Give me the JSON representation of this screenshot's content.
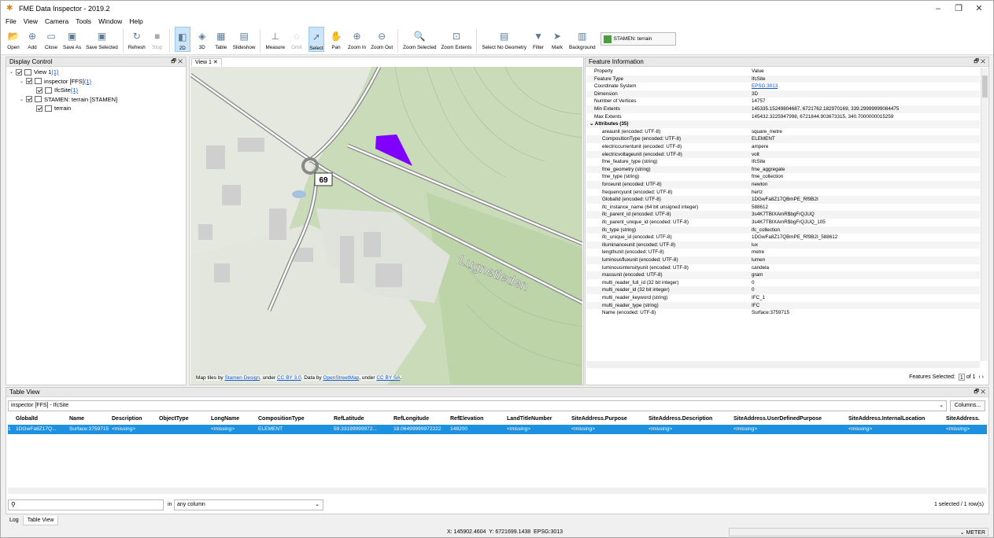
{
  "window": {
    "title": "FME Data Inspector - 2019.2"
  },
  "menu": [
    "File",
    "View",
    "Camera",
    "Tools",
    "Window",
    "Help"
  ],
  "toolbar": [
    {
      "label": "Open",
      "icon": "folder-open-icon"
    },
    {
      "label": "Add",
      "icon": "add-dataset-icon"
    },
    {
      "label": "Close",
      "icon": "folder-close-icon"
    },
    {
      "label": "Save As",
      "icon": "save-as-icon"
    },
    {
      "label": "Save Selected",
      "icon": "save-selected-icon"
    },
    {
      "label": "Refresh",
      "icon": "refresh-icon"
    },
    {
      "label": "Stop",
      "icon": "stop-icon",
      "disabled": true
    },
    {
      "label": "2D",
      "icon": "2d-icon",
      "active": true
    },
    {
      "label": "3D",
      "icon": "3d-icon"
    },
    {
      "label": "Table",
      "icon": "table-icon"
    },
    {
      "label": "Slideshow",
      "icon": "slideshow-icon"
    },
    {
      "label": "Measure",
      "icon": "measure-icon"
    },
    {
      "label": "Orbit",
      "icon": "orbit-icon",
      "disabled": true
    },
    {
      "label": "Select",
      "icon": "select-icon",
      "active": true
    },
    {
      "label": "Pan",
      "icon": "pan-icon"
    },
    {
      "label": "Zoom In",
      "icon": "zoom-in-icon"
    },
    {
      "label": "Zoom Out",
      "icon": "zoom-out-icon"
    },
    {
      "label": "Zoom Selected",
      "icon": "zoom-selected-icon"
    },
    {
      "label": "Zoom Extents",
      "icon": "zoom-extents-icon"
    },
    {
      "label": "Select No Geometry",
      "icon": "select-no-geometry-icon"
    },
    {
      "label": "Filter",
      "icon": "filter-icon"
    },
    {
      "label": "Mark",
      "icon": "mark-icon"
    },
    {
      "label": "Background",
      "icon": "background-icon"
    }
  ],
  "background_select": "STAMEN: terrain",
  "display_control": {
    "title": "Display Control",
    "items": [
      {
        "text": "View 1",
        "count": "(1)",
        "indent": 0
      },
      {
        "text": "inspector [FFS]",
        "count": "(1)",
        "indent": 1
      },
      {
        "text": "IfcSite",
        "count": "(1)",
        "indent": 2
      },
      {
        "text": "STAMEN: terrain [STAMEN]",
        "count": "",
        "indent": 1
      },
      {
        "text": "terrain",
        "count": "",
        "indent": 2
      }
    ]
  },
  "view": {
    "tab": "View 1",
    "route_label": "69",
    "street_label": "Lugnetleden",
    "credit": {
      "a": "Map tiles by ",
      "l1": "Stamen Design",
      "b": ", under ",
      "l2": "CC BY 3.0",
      "c": ". Data by ",
      "l3": "OpenStreetMap",
      "d": ", under ",
      "l4": "CC BY SA",
      "e": "."
    }
  },
  "feature_info": {
    "title": "Feature Information",
    "headers": [
      "Property",
      "Value"
    ],
    "rows": [
      [
        "Feature Type",
        "IfcSite"
      ],
      [
        "Coordinate System",
        "EPSG:3013"
      ],
      [
        "Dimension",
        "3D"
      ],
      [
        "Number of Vertices",
        "14757"
      ],
      [
        "Min Extents",
        "145335.15249804687, 6721762.182970169, 339.29999999084475"
      ],
      [
        "Max Extents",
        "145432.3225947998, 6721844.903673315, 340.7000000015259"
      ],
      [
        "Attributes (35)",
        ""
      ],
      [
        "areaunit (encoded: UTF-8)",
        "square_metre"
      ],
      [
        "CompositionType (encoded: UTF-8)",
        "ELEMENT"
      ],
      [
        "electriccurrentunit (encoded: UTF-8)",
        "ampere"
      ],
      [
        "electricvoltageunit (encoded: UTF-8)",
        "volt"
      ],
      [
        "fme_feature_type (string)",
        "IfcSite"
      ],
      [
        "fme_geometry (string)",
        "fme_aggregate"
      ],
      [
        "fme_type (string)",
        "fme_collection"
      ],
      [
        "forceunit (encoded: UTF-8)",
        "newton"
      ],
      [
        "frequencyunit (encoded: UTF-8)",
        "hertz"
      ],
      [
        "GlobalId (encoded: UTF-8)",
        "1DGwFa8Z17QBmPE_Rf9B2I"
      ],
      [
        "ifc_instance_name (64 bit unsigned integer)",
        "588612"
      ],
      [
        "ifc_parent_id (encoded: UTF-8)",
        "3s4K7TBIXAmR$bgFrQJUQ"
      ],
      [
        "ifc_parent_unique_id (encoded: UTF-8)",
        "3s4K7TBIXAmR$bgFrQJUQ_105"
      ],
      [
        "ifc_type (string)",
        "ifc_collection"
      ],
      [
        "ifc_unique_id (encoded: UTF-8)",
        "1DGwFa8Z17QBmPE_Rf9B2I_588612"
      ],
      [
        "illuminanceunit (encoded: UTF-8)",
        "lux"
      ],
      [
        "lengthunit (encoded: UTF-8)",
        "metre"
      ],
      [
        "luminousfluxunit (encoded: UTF-8)",
        "lumen"
      ],
      [
        "luminousintensityunit (encoded: UTF-8)",
        "candela"
      ],
      [
        "massunit (encoded: UTF-8)",
        "gram"
      ],
      [
        "multi_reader_full_id (32 bit integer)",
        "0"
      ],
      [
        "multi_reader_id (32 bit integer)",
        "0"
      ],
      [
        "multi_reader_keyword (string)",
        "IFC_1"
      ],
      [
        "multi_reader_type (string)",
        "IFC"
      ],
      [
        "Name (encoded: UTF-8)",
        "Surface:3759715"
      ]
    ],
    "footer": {
      "label": "Features Selected:",
      "page": "1",
      "of": "of 1"
    }
  },
  "table_view": {
    "title": "Table View",
    "source": "inspector [FFS] - IfcSite",
    "columns_btn": "Columns...",
    "headers": [
      "GlobalId",
      "Name",
      "Description",
      "ObjectType",
      "LongName",
      "CompositionType",
      "RefLatitude",
      "RefLongitude",
      "RefElevation",
      "LandTitleNumber",
      "SiteAddress.Purpose",
      "SiteAddress.Description",
      "SiteAddress.UserDefinedPurpose",
      "SiteAddress.InternalLocation",
      "SiteAddress."
    ],
    "row": [
      "1DGwFa8Z17Q...",
      "Surface:3759715",
      "<missing>",
      "",
      "<missing>",
      "ELEMENT",
      "59.33199999972...",
      "18.06499999972222",
      "148200",
      "<missing>",
      "<missing>",
      "<missing>",
      "<missing>",
      "<missing>",
      "<missing>"
    ],
    "row_num": "1",
    "search_in": "in",
    "search_col": "any column",
    "count": "1 selected / 1 row(s)"
  },
  "bottom_tabs": [
    "Log",
    "Table View"
  ],
  "status": {
    "x": "X:  145902.4604",
    "y": "Y:  6721699.1438",
    "epsg": "EPSG:3013",
    "units": "METER"
  }
}
